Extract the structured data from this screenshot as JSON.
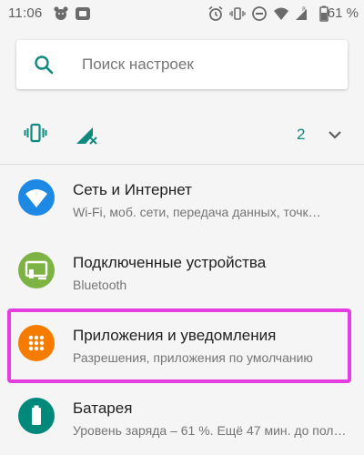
{
  "status_bar": {
    "time": "11:06",
    "battery": "61 %"
  },
  "search": {
    "placeholder": "Поиск настроек"
  },
  "conditions": {
    "count": "2"
  },
  "settings": [
    {
      "title": "Сеть и Интернет",
      "subtitle": "Wi-Fi, моб. сети, передача данных, точк…",
      "icon": "wifi-icon",
      "color": "#1e88e5"
    },
    {
      "title": "Подключенные устройства",
      "subtitle": "Bluetooth",
      "icon": "connected-devices-icon",
      "color": "#7cb342"
    },
    {
      "title": "Приложения и уведомления",
      "subtitle": "Разрешения, приложения по умолчанию",
      "icon": "apps-icon",
      "color": "#f57c00"
    },
    {
      "title": "Батарея",
      "subtitle": "Уровень заряда – 61 %. Ещё 47 мин. до пол…",
      "icon": "battery-icon",
      "color": "#00897b"
    }
  ],
  "colors": {
    "accent": "#0f8a7e",
    "highlight": "#e43de0"
  }
}
